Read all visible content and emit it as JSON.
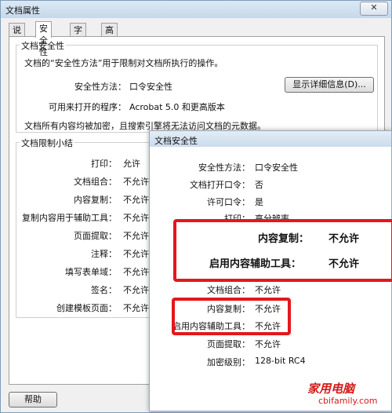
{
  "window": {
    "title": "文档属性",
    "close_label": "✕"
  },
  "tabs": [
    "说明",
    "安全性",
    "字体",
    "高级"
  ],
  "security": {
    "group_label": "文档安全性",
    "description": "文档的“安全性方法”用于限制对文档所执行的操作。",
    "method_label": "安全性方法：",
    "method_value": "口令安全性",
    "details_button": "显示详细信息(D)...",
    "openable_label": "可用来打开的程序：",
    "openable_value": "Acrobat 5.0 和更高版本",
    "note": "文档所有内容均被加密，且搜索引擎将无法访问文档的元数据。"
  },
  "restrictions": {
    "group_label": "文档限制小结",
    "rows": [
      {
        "label": "打印：",
        "value": "允许"
      },
      {
        "label": "文档组合：",
        "value": "不允许"
      },
      {
        "label": "内容复制：",
        "value": "不允许"
      },
      {
        "label": "复制内容用于辅助工具：",
        "value": "不允许"
      },
      {
        "label": "页面提取：",
        "value": "不允许"
      },
      {
        "label": "注释：",
        "value": "不允许"
      },
      {
        "label": "填写表单域：",
        "value": "不允许"
      },
      {
        "label": "签名：",
        "value": "不允许"
      },
      {
        "label": "创建模板页面：",
        "value": "不允许"
      }
    ]
  },
  "help_button": "帮助",
  "overlay": {
    "title": "文档安全性",
    "rows": [
      {
        "label": "安全性方法：",
        "value": "口令安全性"
      },
      {
        "label": "文档打开口令：",
        "value": "否"
      },
      {
        "label": "许可口令：",
        "value": "是"
      },
      {
        "label": "打印：",
        "value": "高分辨率"
      },
      {
        "label": "文档组合：",
        "value": "不允许"
      },
      {
        "label": "内容复制：",
        "value": "不允许"
      },
      {
        "label": "启用内容辅助工具：",
        "value": "不允许"
      },
      {
        "label": "页面提取：",
        "value": "不允许"
      },
      {
        "label": "加密级别：",
        "value": "128-bit RC4"
      }
    ],
    "zoom": [
      {
        "label": "内容复制：",
        "value": "不允许"
      },
      {
        "label": "启用内容辅助工具：",
        "value": "不允许"
      }
    ]
  },
  "watermark": {
    "brand": "家用电脑",
    "url": "cbifamily.com"
  },
  "colors": {
    "highlight": "#e3171d",
    "title_bar": "#cfe0f0"
  }
}
